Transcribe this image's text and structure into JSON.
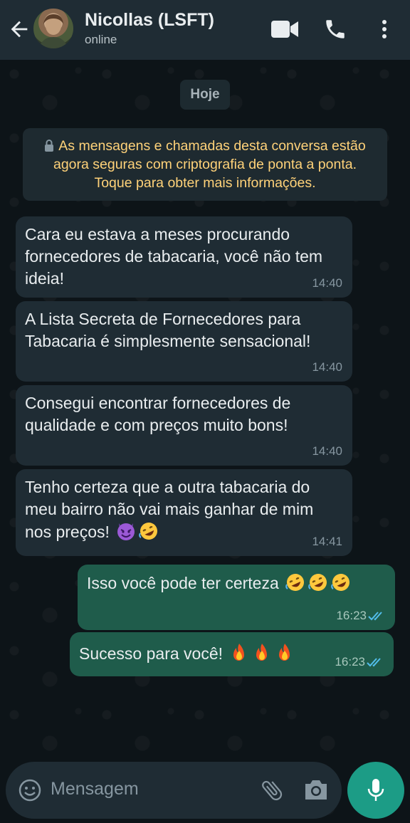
{
  "header": {
    "contact_name": "Nicollas (LSFT)",
    "status": "online",
    "icons": [
      "back-arrow-icon",
      "video-call-icon",
      "phone-icon",
      "more-vert-icon"
    ]
  },
  "date_chip": "Hoje",
  "encryption_notice": "As mensagens e chamadas desta conversa estão agora seguras com criptografia de ponta a ponta. Toque para obter mais informações.",
  "messages": [
    {
      "direction": "incoming",
      "text": "Cara eu estava a meses procurando fornecedores de tabacaria, você não tem ideia!",
      "time": "14:40"
    },
    {
      "direction": "incoming",
      "text": "A Lista Secreta de Fornecedores para Tabacaria é simplesmente sensacional!",
      "time": "14:40"
    },
    {
      "direction": "incoming",
      "text": "Consegui encontrar fornecedores de qualidade e com preços muito bons!",
      "time": "14:40"
    },
    {
      "direction": "incoming",
      "text": "Tenho certeza que a outra tabacaria do meu bairro não vai mais ganhar de mim nos preços!",
      "emojis": [
        "smiling-imp-icon",
        "rofl-icon"
      ],
      "time": "14:41"
    },
    {
      "direction": "outgoing",
      "text": "Isso você pode ter certeza",
      "emojis": [
        "rofl-icon",
        "rofl-icon",
        "rofl-icon"
      ],
      "time": "16:23",
      "read": true
    },
    {
      "direction": "outgoing",
      "text": "Sucesso para você!",
      "emojis": [
        "fire-icon",
        "fire-icon",
        "fire-icon"
      ],
      "time": "16:23",
      "read": true
    }
  ],
  "composer": {
    "placeholder": "Mensagem",
    "icons": [
      "emoji-icon",
      "attach-icon",
      "camera-icon",
      "mic-icon"
    ]
  },
  "colors": {
    "header_bg": "#1f2c34",
    "incoming_bubble": "#1f2c34",
    "outgoing_bubble": "#1f5c4b",
    "encryption_text": "#ffd279",
    "mic_button": "#1c9c86",
    "read_ticks": "#53bdeb"
  }
}
